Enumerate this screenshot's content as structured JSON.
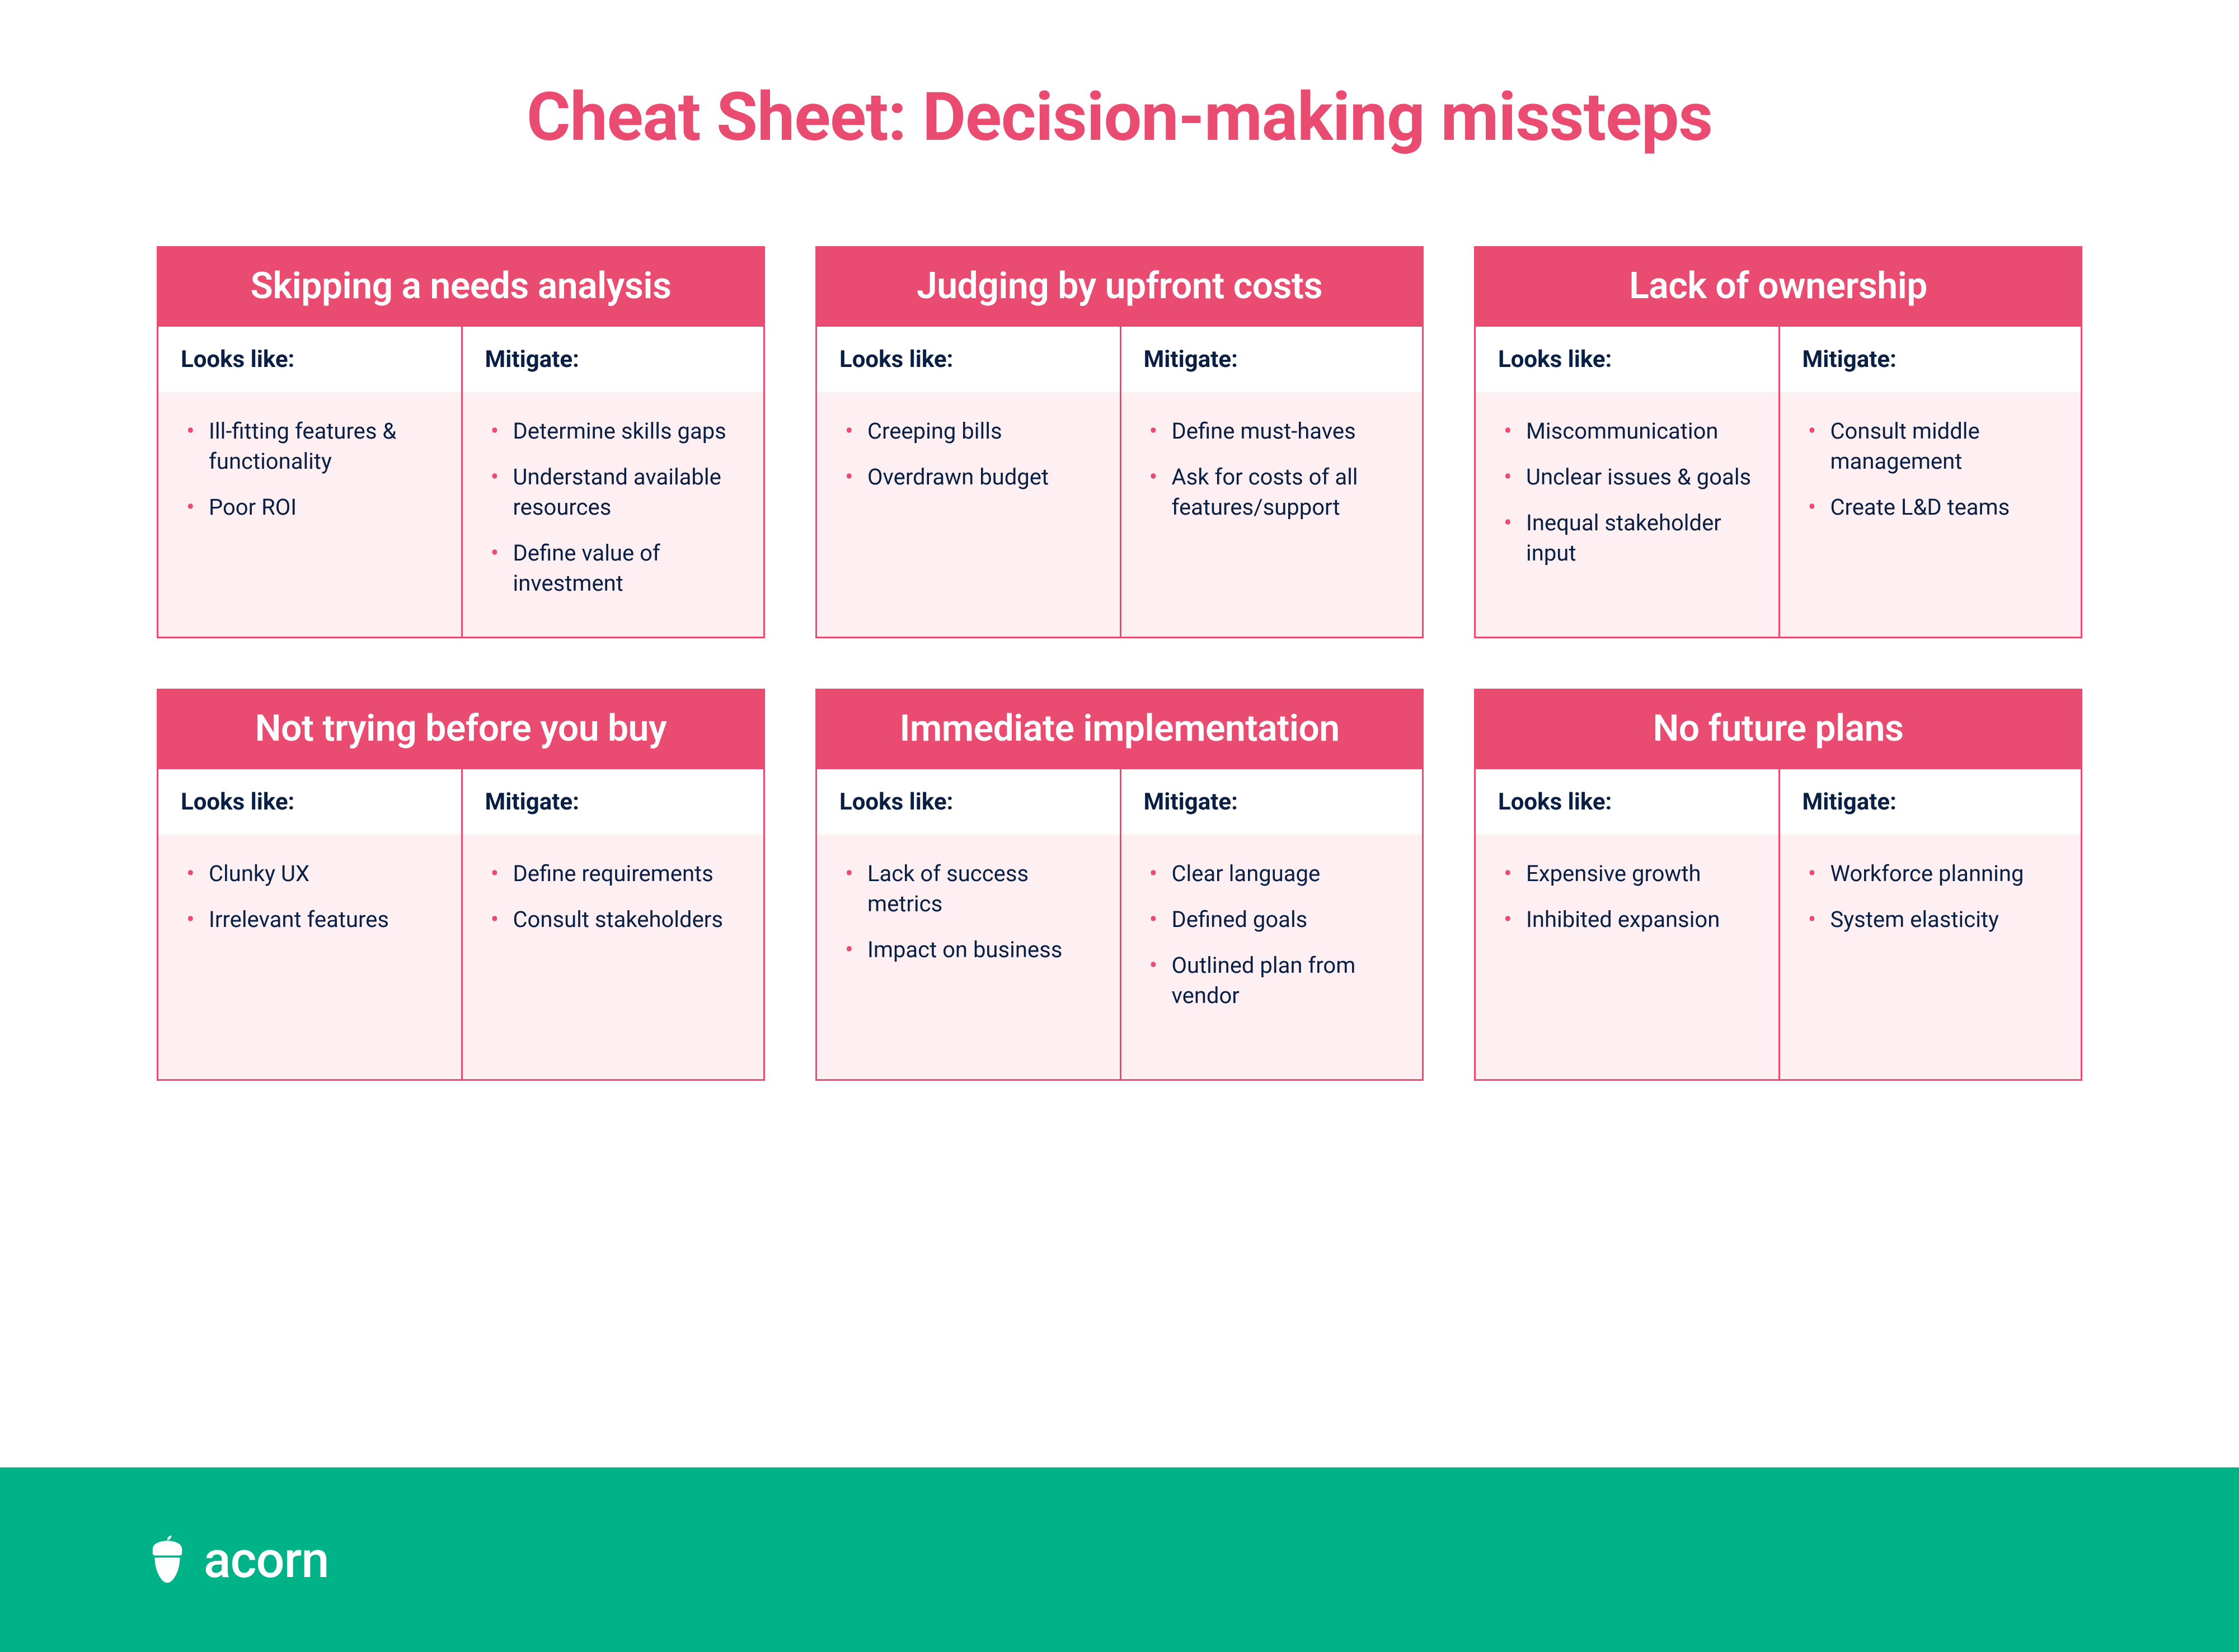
{
  "title": "Cheat Sheet: Decision-making missteps",
  "labels": {
    "looks_like": "Looks like:",
    "mitigate": "Mitigate:"
  },
  "colors": {
    "accent": "#e94b71",
    "footer": "#00b287",
    "text": "#0a1f44",
    "card_bg": "#fdeff2"
  },
  "cards": [
    {
      "heading": "Skipping a needs analysis",
      "looks_like": [
        "Ill-fitting features & functionality",
        "Poor ROI"
      ],
      "mitigate": [
        "Determine skills gaps",
        "Understand available resources",
        "Define value of investment"
      ]
    },
    {
      "heading": "Judging by upfront costs",
      "looks_like": [
        "Creeping bills",
        "Overdrawn budget"
      ],
      "mitigate": [
        "Define must-haves",
        "Ask for costs of all features/support"
      ]
    },
    {
      "heading": "Lack of ownership",
      "looks_like": [
        "Miscommunication",
        "Unclear issues & goals",
        "Inequal stakeholder input"
      ],
      "mitigate": [
        "Consult middle management",
        "Create L&D teams"
      ]
    },
    {
      "heading": "Not trying before you buy",
      "looks_like": [
        "Clunky UX",
        "Irrelevant features"
      ],
      "mitigate": [
        "Define requirements",
        "Consult stakeholders"
      ]
    },
    {
      "heading": "Immediate implementation",
      "looks_like": [
        "Lack of success metrics",
        "Impact on business"
      ],
      "mitigate": [
        "Clear language",
        "Defined goals",
        "Outlined plan from vendor"
      ]
    },
    {
      "heading": "No future plans",
      "looks_like": [
        "Expensive growth",
        "Inhibited expansion"
      ],
      "mitigate": [
        "Workforce planning",
        "System elasticity"
      ]
    }
  ],
  "footer": {
    "brand": "acorn",
    "icon": "acorn-icon"
  }
}
